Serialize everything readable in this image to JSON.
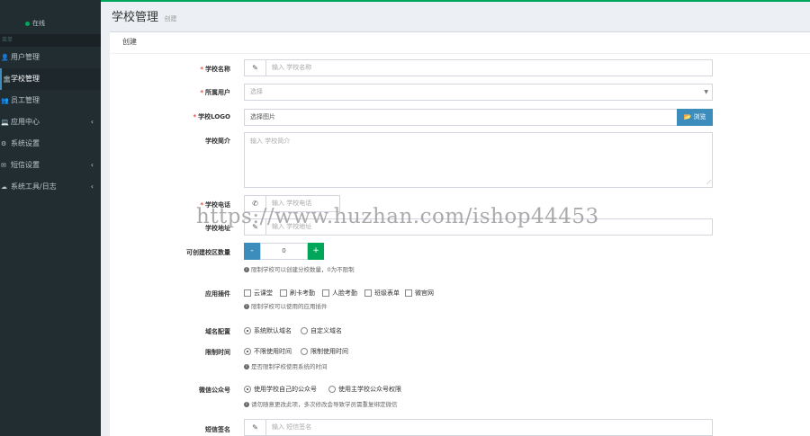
{
  "sidebar": {
    "status": "在线",
    "menu_header": "菜单",
    "items": [
      {
        "label": "用户管理",
        "icon": "user-icon",
        "glyph": "👤",
        "chevron": ""
      },
      {
        "label": "学校管理",
        "icon": "bank-icon",
        "glyph": "🏛",
        "chevron": ""
      },
      {
        "label": "员工管理",
        "icon": "users-icon",
        "glyph": "👥",
        "chevron": ""
      },
      {
        "label": "应用中心",
        "icon": "laptop-icon",
        "glyph": "💻",
        "chevron": "‹"
      },
      {
        "label": "系统设置",
        "icon": "cogs-icon",
        "glyph": "⚙",
        "chevron": ""
      },
      {
        "label": "短信设置",
        "icon": "message-icon",
        "glyph": "✉",
        "chevron": "‹"
      },
      {
        "label": "系统工具/日志",
        "icon": "cloud-icon",
        "glyph": "☁",
        "chevron": "‹"
      }
    ]
  },
  "header": {
    "title": "学校管理",
    "subtitle": "创建"
  },
  "box": {
    "title": "创建"
  },
  "form": {
    "school_name": {
      "label": "学校名称",
      "placeholder": "输入 学校名称"
    },
    "owner": {
      "label": "所属用户",
      "placeholder": "选择"
    },
    "logo": {
      "label": "学校LOGO",
      "value": "选择图片",
      "browse": "浏览"
    },
    "intro": {
      "label": "学校简介",
      "placeholder": "输入 学校简介"
    },
    "phone": {
      "label": "学校电话",
      "placeholder": "输入 学校电话"
    },
    "address": {
      "label": "学校地址",
      "placeholder": "输入 学校地址"
    },
    "campus_count": {
      "label": "可创建校区数量",
      "value": "0",
      "help": "限制学校可以创建分校数量，0为不限制"
    },
    "plugins": {
      "label": "应用插件",
      "options": [
        "云课堂",
        "刷卡考勤",
        "人脸考勤",
        "班级表单",
        "微官网"
      ],
      "help": "限制学校可以使用的应用插件"
    },
    "domain": {
      "label": "域名配置",
      "options": [
        "系统默认域名",
        "自定义域名"
      ],
      "selected": 0
    },
    "time_limit": {
      "label": "限制时间",
      "options": [
        "不限使用时间",
        "限制使用时间"
      ],
      "selected": 0,
      "help": "是否限制学校使用系统的时间"
    },
    "wechat": {
      "label": "微信公众号",
      "options": [
        "使用学校自己的公众号",
        "使用主学校公众号权限"
      ],
      "selected": 0,
      "help": "请勿随意更改此项，多次修改会导致学员需重复绑定微信"
    },
    "sms_sign": {
      "label": "短信签名",
      "placeholder": "输入 短信签名"
    }
  },
  "watermark": "https://www.huzhan.com/ishop44453"
}
